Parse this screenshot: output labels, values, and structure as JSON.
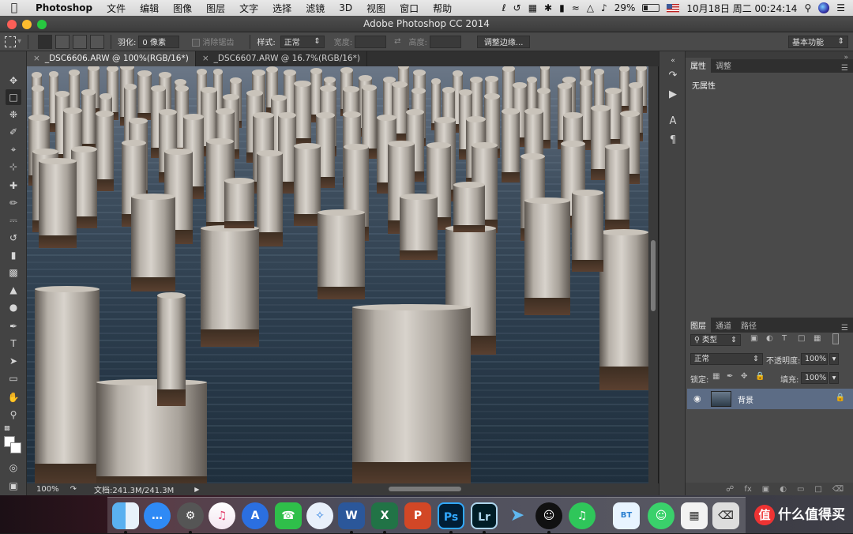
{
  "menubar": {
    "apple_icon": "apple-icon",
    "items": [
      "Photoshop",
      "文件",
      "编辑",
      "图像",
      "图层",
      "文字",
      "选择",
      "滤镜",
      "3D",
      "视图",
      "窗口",
      "帮助"
    ],
    "battery": "29%",
    "datetime": "10月18日 周二  00:24:14"
  },
  "window": {
    "title": "Adobe Photoshop CC 2014"
  },
  "options": {
    "feather_label": "羽化:",
    "feather_value": "0 像素",
    "antialias_label": "消除锯齿",
    "style_label": "样式:",
    "style_value": "正常",
    "width_label": "宽度:",
    "height_label": "高度:",
    "refine_edge": "调整边缘...",
    "workspace": "基本功能"
  },
  "tabs": [
    {
      "label": "_DSC6606.ARW @ 100%(RGB/16*)",
      "active": true
    },
    {
      "label": "_DSC6607.ARW @ 16.7%(RGB/16*)",
      "active": false
    }
  ],
  "status": {
    "zoom": "100%",
    "doc_size": "文档:241.3M/241.3M"
  },
  "properties_panel": {
    "tabs": [
      "属性",
      "调整"
    ],
    "content": "无属性"
  },
  "layers_panel": {
    "tabs": [
      "图层",
      "通道",
      "路径"
    ],
    "filter_kind": "类型",
    "blend_mode": "正常",
    "opacity_label": "不透明度:",
    "opacity_value": "100%",
    "lock_label": "锁定:",
    "fill_label": "填充:",
    "fill_value": "100%",
    "layers": [
      {
        "name": "背景",
        "locked": true,
        "visible": true
      }
    ]
  },
  "dock": {
    "apps": [
      "Finder",
      "信息",
      "系统偏好设置",
      "iTunes",
      "Instruments",
      "FaceTime",
      "Safari",
      "W",
      "X",
      "P",
      "Ps",
      "Lr",
      "飞书",
      "QQ",
      "QQ音乐",
      "BT",
      "微信",
      "备忘"
    ]
  },
  "watermark": "什么值得买",
  "watermark_logo": "值"
}
